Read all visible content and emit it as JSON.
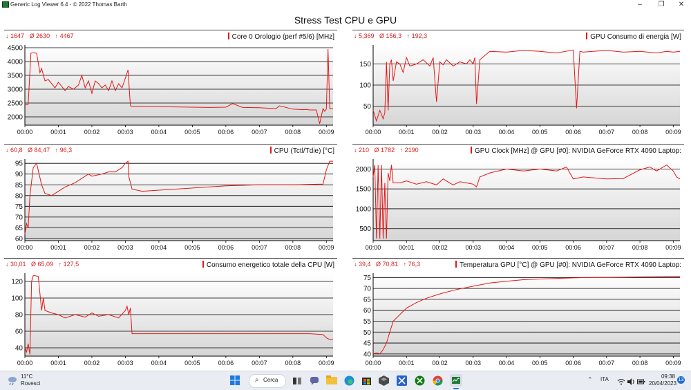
{
  "window": {
    "title": "Generic Log Viewer 6.4 - © 2022 Thomas Barth",
    "minimize": "–",
    "maximize": "❐",
    "close": "✕"
  },
  "main_title": "Stress Test CPU e GPU",
  "colors": {
    "line": "#e51616",
    "accent": "#e51616",
    "grid": "#000000"
  },
  "panels": [
    {
      "title": "Core 0 Orologio (perf #5/6) [MHz]",
      "stat_min": "↓ 1647",
      "stat_avg": "Ø 2630",
      "stat_max": "↑ 4467"
    },
    {
      "title": "GPU Consumo di energia [W]",
      "stat_min": "↓ 5,369",
      "stat_avg": "Ø 156,3",
      "stat_max": "↑ 192,3"
    },
    {
      "title": "CPU (Tctl/Tdie) [°C]",
      "stat_min": "↓ 60,8",
      "stat_avg": "Ø 84,47",
      "stat_max": "↑ 96,3"
    },
    {
      "title": "GPU Clock [MHz] @ GPU [#0]: NVIDIA GeForce RTX 4090 Laptop:",
      "stat_min": "↓ 210",
      "stat_avg": "Ø 1782",
      "stat_max": "↑ 2190"
    },
    {
      "title": "Consumo energetico totale della CPU [W]",
      "stat_min": "↓ 30,01",
      "stat_avg": "Ø 65,09",
      "stat_max": "↑ 127,5"
    },
    {
      "title": "Temperatura GPU [°C] @ GPU [#0]: NVIDIA GeForce RTX 4090 Laptop:",
      "stat_min": "↓ 39,4",
      "stat_avg": "Ø 70,81",
      "stat_max": "↑ 76,3"
    }
  ],
  "chart_data": [
    {
      "type": "line",
      "title": "Core 0 Orologio (perf #5/6) [MHz]",
      "x_ticks": [
        "00:00",
        "00:01",
        "00:02",
        "00:03",
        "00:04",
        "00:05",
        "00:06",
        "00:07",
        "00:08",
        "00:09"
      ],
      "y_ticks": [
        2000,
        2500,
        3000,
        3500,
        4000,
        4500
      ],
      "ylim": [
        1700,
        4600
      ],
      "xlim_minutes": [
        0,
        9.2
      ],
      "series": [
        {
          "x": [
            0,
            0.1,
            0.18,
            0.25,
            0.35,
            0.45,
            0.5,
            0.6,
            0.7,
            0.8,
            0.9,
            1.0,
            1.1,
            1.2,
            1.3,
            1.45,
            1.6,
            1.7,
            1.8,
            1.9,
            2.0,
            2.1,
            2.2,
            2.3,
            2.4,
            2.5,
            2.6,
            2.7,
            2.8,
            2.9,
            3.0,
            3.08,
            3.15,
            3.2,
            3.5,
            4.0,
            4.5,
            5.0,
            5.5,
            6.0,
            6.2,
            6.5,
            7.0,
            7.5,
            7.6,
            8.0,
            8.3,
            8.4,
            8.5,
            8.7,
            8.8,
            8.9,
            8.95,
            9.0,
            9.05,
            9.1,
            9.2
          ],
          "y": [
            2420,
            2450,
            4300,
            4320,
            4300,
            3600,
            3750,
            3300,
            3350,
            3200,
            3050,
            3250,
            3100,
            2950,
            3100,
            3000,
            3150,
            3500,
            3050,
            3300,
            2850,
            3300,
            3200,
            3050,
            3150,
            2950,
            3300,
            2950,
            3200,
            3050,
            3400,
            3700,
            2400,
            2380,
            2380,
            2370,
            2360,
            2350,
            2340,
            2350,
            2480,
            2340,
            2330,
            2300,
            2400,
            2280,
            2260,
            2270,
            2250,
            2250,
            1750,
            2300,
            2200,
            2280,
            4450,
            2300,
            2300
          ]
        }
      ]
    },
    {
      "type": "line",
      "title": "GPU Consumo di energia [W]",
      "x_ticks": [
        "00:00",
        "00:01",
        "00:02",
        "00:03",
        "00:04",
        "00:05",
        "00:06",
        "00:07",
        "00:08",
        "00:09"
      ],
      "y_ticks": [
        50,
        100,
        150
      ],
      "ylim": [
        5,
        195
      ],
      "xlim_minutes": [
        0,
        9.2
      ],
      "series": [
        {
          "x": [
            0,
            0.1,
            0.2,
            0.3,
            0.35,
            0.4,
            0.45,
            0.5,
            0.55,
            0.6,
            0.7,
            0.8,
            0.9,
            1.0,
            1.1,
            1.3,
            1.5,
            1.7,
            1.8,
            1.9,
            2.0,
            2.1,
            2.2,
            2.4,
            2.6,
            2.8,
            2.9,
            3.0,
            3.05,
            3.1,
            3.2,
            3.5,
            4.0,
            4.5,
            5.0,
            5.5,
            6.0,
            6.1,
            6.2,
            6.3,
            6.6,
            7.0,
            7.5,
            8.0,
            8.5,
            8.8,
            9.0,
            9.2
          ],
          "y": [
            40,
            15,
            40,
            20,
            35,
            155,
            40,
            150,
            160,
            110,
            155,
            150,
            130,
            165,
            145,
            150,
            160,
            145,
            165,
            60,
            155,
            148,
            160,
            145,
            155,
            150,
            160,
            150,
            165,
            55,
            160,
            180,
            178,
            182,
            180,
            176,
            183,
            45,
            180,
            178,
            180,
            182,
            178,
            180,
            176,
            180,
            178,
            180
          ]
        }
      ]
    },
    {
      "type": "line",
      "title": "CPU (Tctl/Tdie) [°C]",
      "x_ticks": [
        "00:00",
        "00:01",
        "00:02",
        "00:03",
        "00:04",
        "00:05",
        "00:06",
        "00:07",
        "00:08",
        "00:09"
      ],
      "y_ticks": [
        60,
        65,
        70,
        75,
        80,
        85,
        90,
        95
      ],
      "ylim": [
        59,
        97
      ],
      "xlim_minutes": [
        0,
        9.2
      ],
      "series": [
        {
          "x": [
            0,
            0.05,
            0.1,
            0.15,
            0.25,
            0.35,
            0.5,
            0.6,
            0.8,
            1.0,
            1.2,
            1.5,
            1.7,
            1.9,
            2.0,
            2.3,
            2.5,
            2.7,
            2.9,
            3.0,
            3.08,
            3.1,
            3.2,
            3.5,
            4.0,
            5.0,
            6.0,
            7.0,
            8.0,
            8.5,
            8.9,
            9.0,
            9.1,
            9.2
          ],
          "y": [
            62,
            67,
            65,
            80,
            93,
            95,
            85,
            81,
            80,
            82,
            84,
            86,
            88,
            90,
            89,
            90,
            91,
            91,
            93,
            95,
            96,
            89,
            83,
            82,
            82.5,
            83.5,
            84.5,
            85,
            85,
            85.2,
            85.3,
            92,
            96,
            96
          ]
        }
      ]
    },
    {
      "type": "line",
      "title": "GPU Clock [MHz] @ GPU [#0]: NVIDIA GeForce RTX 4090 Laptop:",
      "x_ticks": [
        "00:00",
        "00:01",
        "00:02",
        "00:03",
        "00:04",
        "00:05",
        "00:06",
        "00:07",
        "00:08",
        "00:09"
      ],
      "y_ticks": [
        500,
        1000,
        1500,
        2000
      ],
      "ylim": [
        200,
        2250
      ],
      "xlim_minutes": [
        0,
        9.2
      ],
      "series": [
        {
          "x": [
            0,
            0.05,
            0.1,
            0.15,
            0.2,
            0.25,
            0.3,
            0.35,
            0.4,
            0.45,
            0.5,
            0.55,
            0.6,
            0.8,
            1.0,
            1.3,
            1.6,
            1.9,
            2.1,
            2.4,
            2.6,
            2.8,
            3.0,
            3.1,
            3.2,
            3.5,
            4.0,
            4.5,
            5.0,
            5.5,
            5.8,
            6.0,
            6.3,
            6.6,
            7.0,
            7.5,
            8.0,
            8.3,
            8.5,
            8.8,
            9.0,
            9.1,
            9.2
          ],
          "y": [
            1800,
            2100,
            250,
            2100,
            250,
            2100,
            250,
            1650,
            250,
            1900,
            1700,
            2100,
            1650,
            1650,
            1700,
            1620,
            1680,
            1600,
            1750,
            1600,
            1680,
            1650,
            1620,
            1550,
            1800,
            1900,
            2000,
            1950,
            2000,
            1950,
            2050,
            1750,
            1800,
            1780,
            1750,
            1760,
            1980,
            2050,
            1950,
            2100,
            1950,
            1800,
            1750
          ]
        }
      ]
    },
    {
      "type": "line",
      "title": "Consumo energetico totale della CPU [W]",
      "x_ticks": [
        "00:00",
        "00:01",
        "00:02",
        "00:03",
        "00:04",
        "00:05",
        "00:06",
        "00:07",
        "00:08",
        "00:09"
      ],
      "y_ticks": [
        40,
        60,
        80,
        100,
        120
      ],
      "ylim": [
        30,
        130
      ],
      "xlim_minutes": [
        0,
        9.2
      ],
      "series": [
        {
          "x": [
            0,
            0.05,
            0.1,
            0.15,
            0.2,
            0.25,
            0.3,
            0.4,
            0.5,
            0.55,
            0.6,
            0.8,
            1.0,
            1.2,
            1.5,
            1.8,
            2.0,
            2.2,
            2.5,
            2.8,
            3.0,
            3.05,
            3.1,
            3.15,
            3.2,
            3.5,
            4.0,
            5.0,
            6.0,
            7.0,
            8.0,
            8.5,
            8.9,
            9.0,
            9.1,
            9.2
          ],
          "y": [
            40,
            35,
            45,
            32,
            120,
            127,
            127,
            126,
            85,
            100,
            85,
            82,
            80,
            76,
            80,
            77,
            82,
            78,
            80,
            76,
            85,
            90,
            80,
            88,
            57,
            57,
            57,
            57,
            57,
            57,
            57,
            57,
            56,
            52,
            50,
            50
          ]
        }
      ]
    },
    {
      "type": "line",
      "title": "Temperatura GPU [°C] @ GPU [#0]: NVIDIA GeForce RTX 4090 Laptop:",
      "x_ticks": [
        "00:00",
        "00:01",
        "00:02",
        "00:03",
        "00:04",
        "00:05",
        "00:06",
        "00:07",
        "00:08",
        "00:09"
      ],
      "y_ticks": [
        40,
        45,
        50,
        55,
        60,
        65,
        70,
        75
      ],
      "ylim": [
        39,
        77
      ],
      "xlim_minutes": [
        0,
        9.2
      ],
      "series": [
        {
          "x": [
            0,
            0.1,
            0.2,
            0.3,
            0.4,
            0.5,
            0.6,
            0.8,
            1.0,
            1.3,
            1.6,
            2.0,
            2.5,
            3.0,
            3.5,
            4.0,
            4.5,
            5.0,
            5.5,
            6.0,
            6.5,
            7.0,
            7.5,
            8.0,
            8.5,
            9.0,
            9.2
          ],
          "y": [
            40,
            40.5,
            40,
            42,
            45,
            50,
            55,
            58,
            61,
            63.5,
            65.5,
            67.5,
            69.5,
            71,
            72.5,
            73.3,
            74,
            74.3,
            74.6,
            74.8,
            75,
            75.1,
            75.2,
            75.3,
            75.4,
            75.5,
            75.5
          ]
        }
      ]
    }
  ],
  "taskbar": {
    "weather_temp": "11°C",
    "weather_desc": "Rovesci",
    "search_label": "Cerca",
    "language": "ITA",
    "time": "09:38",
    "date": "20/04/2023",
    "notifications": "13",
    "icons": [
      "windows-start-icon",
      "search-icon",
      "task-view-icon",
      "teams-chat-icon",
      "file-explorer-icon",
      "edge-icon",
      "store-icon",
      "terminal-icon",
      "xbox-icon",
      "chrome-icon",
      "log-viewer-icon"
    ]
  }
}
